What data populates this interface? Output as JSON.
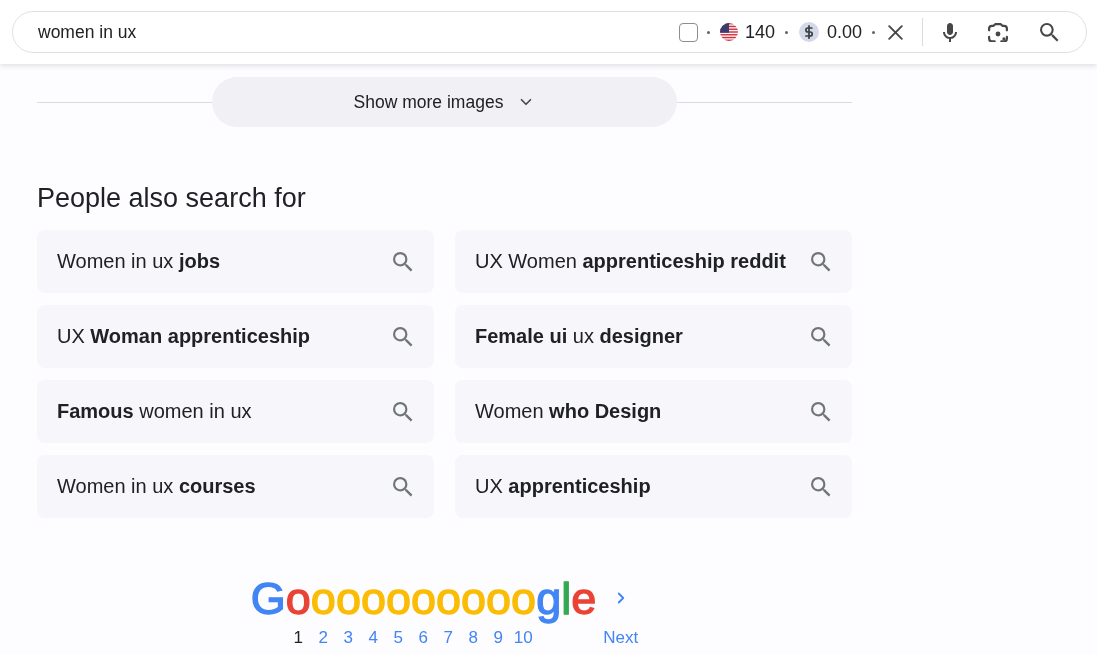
{
  "search_bar": {
    "query": "women in ux",
    "checkbox": {
      "checked": false
    },
    "search_volume": "140",
    "cost": "0.00"
  },
  "show_more_images": {
    "label": "Show more images"
  },
  "people_also_search": {
    "title": "People also search for",
    "suggestions": [
      "Women in ux **jobs**",
      "UX Women **apprenticeship reddit**",
      "UX **Woman apprenticeship**",
      "**Female ui** ux **designer**",
      "**Famous** women in ux",
      "Women **who Design**",
      "Women in ux **courses**",
      "UX **apprenticeship**"
    ]
  },
  "pagination": {
    "logo": [
      {
        "char": "G",
        "color": "#4285f4"
      },
      {
        "char": "o",
        "color": "#ea4335"
      },
      {
        "char": "o",
        "color": "#fbbc05"
      },
      {
        "char": "o",
        "color": "#fbbc05"
      },
      {
        "char": "o",
        "color": "#fbbc05"
      },
      {
        "char": "o",
        "color": "#fbbc05"
      },
      {
        "char": "o",
        "color": "#fbbc05"
      },
      {
        "char": "o",
        "color": "#fbbc05"
      },
      {
        "char": "o",
        "color": "#fbbc05"
      },
      {
        "char": "o",
        "color": "#fbbc05"
      },
      {
        "char": "o",
        "color": "#fbbc05"
      },
      {
        "char": "g",
        "color": "#4285f4"
      },
      {
        "char": "l",
        "color": "#34a853"
      },
      {
        "char": "e",
        "color": "#ea4335"
      }
    ],
    "pages": [
      {
        "label": "1",
        "selected": true
      },
      {
        "label": "2",
        "selected": false
      },
      {
        "label": "3",
        "selected": false
      },
      {
        "label": "4",
        "selected": false
      },
      {
        "label": "5",
        "selected": false
      },
      {
        "label": "6",
        "selected": false
      },
      {
        "label": "7",
        "selected": false
      },
      {
        "label": "8",
        "selected": false
      },
      {
        "label": "9",
        "selected": false
      },
      {
        "label": "10",
        "selected": false
      }
    ],
    "next": "Next"
  }
}
